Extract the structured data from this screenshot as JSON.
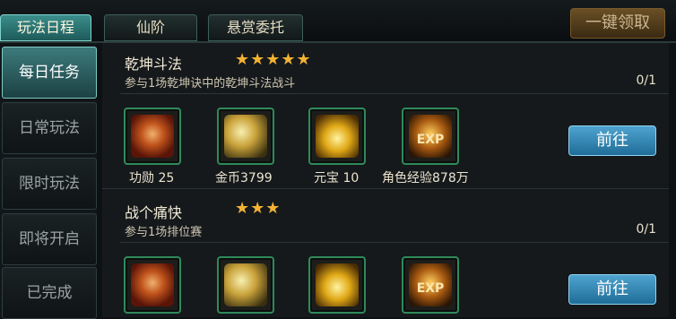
{
  "tabs": [
    "玩法日程",
    "仙阶",
    "悬赏委托"
  ],
  "claim_all_label": "一键领取",
  "sidebar": [
    "每日任务",
    "日常玩法",
    "限时玩法",
    "即将开启",
    "已完成"
  ],
  "tasks": [
    {
      "name": "乾坤斗法",
      "stars": "★★★★★",
      "star_count": 5,
      "description": "参与1场乾坤诀中的乾坤斗法战斗",
      "progress": "0/1",
      "rewards": [
        {
          "icon": "medal-icon",
          "label": "功勋 25"
        },
        {
          "icon": "gold-coins-icon",
          "label": "金币3799"
        },
        {
          "icon": "yuanbao-icon",
          "label": "元宝 10"
        },
        {
          "icon": "exp-icon",
          "icon_text": "EXP",
          "label": "角色经验878万"
        }
      ],
      "go_label": "前往"
    },
    {
      "name": "战个痛快",
      "stars": "★★★",
      "star_count": 3,
      "description": "参与1场排位赛",
      "progress": "0/1",
      "rewards": [
        {
          "icon": "medal-icon"
        },
        {
          "icon": "gold-coins-icon"
        },
        {
          "icon": "yuanbao-icon"
        },
        {
          "icon": "exp-icon",
          "icon_text": "EXP"
        }
      ],
      "go_label": "前往"
    }
  ],
  "colors": {
    "active_tab": "#3b8e8c",
    "star": "#f2b233",
    "go_button": "#2f86b5",
    "reward_border": "#2f8a5a"
  }
}
